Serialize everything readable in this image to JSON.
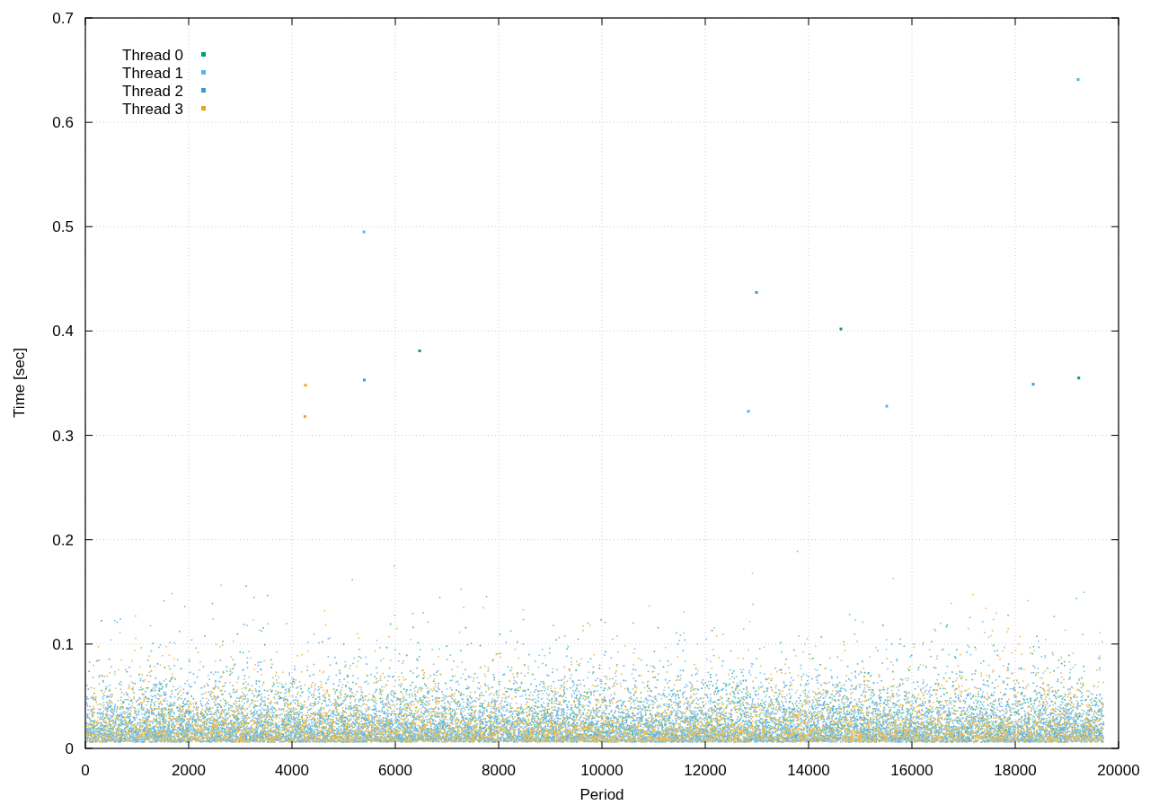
{
  "chart": {
    "chart_data": {
      "type": "scatter",
      "xlabel": "Period",
      "ylabel": "Time [sec]",
      "grid": true,
      "legend": true,
      "xlim": [
        0,
        20000
      ],
      "ylim": [
        0,
        0.7
      ],
      "xticks": [
        0,
        2000,
        4000,
        6000,
        8000,
        10000,
        12000,
        14000,
        16000,
        18000,
        20000
      ],
      "yticks": [
        0,
        0.1,
        0.2,
        0.3,
        0.4,
        0.5,
        0.6,
        0.7
      ],
      "x": [
        4250,
        4261,
        5391,
        5400,
        6470,
        12835,
        12991,
        14626,
        15513,
        18348,
        19217,
        19230
      ],
      "series": [
        {
          "name": "Thread 0",
          "color": "#009e73",
          "values": [
            null,
            null,
            null,
            null,
            0.381,
            null,
            null,
            0.402,
            null,
            null,
            null,
            0.355
          ]
        },
        {
          "name": "Thread 1",
          "color": "#56b4e9",
          "values": [
            null,
            null,
            0.495,
            null,
            null,
            0.323,
            null,
            null,
            0.328,
            null,
            0.641,
            null
          ]
        },
        {
          "name": "Thread 2",
          "color": "#3a9ad9",
          "values": [
            null,
            null,
            null,
            0.353,
            null,
            null,
            0.437,
            null,
            null,
            0.349,
            null,
            null
          ]
        },
        {
          "name": "Thread 3",
          "color": "#e6a817",
          "values": [
            0.318,
            0.348,
            null,
            null,
            null,
            null,
            null,
            null,
            null,
            null,
            null,
            null
          ]
        }
      ]
    }
  }
}
